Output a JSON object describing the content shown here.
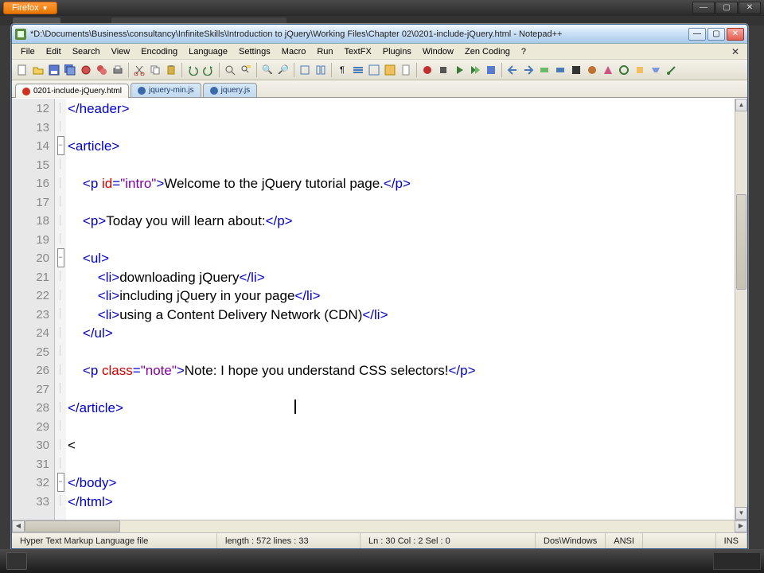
{
  "browser": {
    "name": "Firefox"
  },
  "npp": {
    "title": "*D:\\Documents\\Business\\consultancy\\InfiniteSkills\\Introduction to jQuery\\Working Files\\Chapter 02\\0201-include-jQuery.html - Notepad++",
    "menu": [
      "File",
      "Edit",
      "Search",
      "View",
      "Encoding",
      "Language",
      "Settings",
      "Macro",
      "Run",
      "TextFX",
      "Plugins",
      "Window",
      "Zen Coding",
      "?"
    ],
    "tabs": [
      {
        "label": "0201-include-jQuery.html",
        "active": true
      },
      {
        "label": "jquery-min.js",
        "active": false
      },
      {
        "label": "jquery.js",
        "active": false
      }
    ],
    "gutter_start": 12,
    "code_lines": [
      {
        "n": 12,
        "fold": "",
        "html": "<span class='t-tag'>&lt;/header&gt;</span>"
      },
      {
        "n": 13,
        "fold": "",
        "html": ""
      },
      {
        "n": 14,
        "fold": "box",
        "html": "<span class='t-tag'>&lt;article&gt;</span>"
      },
      {
        "n": 15,
        "fold": "",
        "html": ""
      },
      {
        "n": 16,
        "fold": "",
        "html": "    <span class='t-tag'>&lt;p</span> <span class='t-attr'>id</span><span class='t-tag'>=</span><span class='t-str'>\"intro\"</span><span class='t-tag'>&gt;</span><span class='t-text'>Welcome to the jQuery tutorial page.</span><span class='t-tag'>&lt;/p&gt;</span>"
      },
      {
        "n": 17,
        "fold": "",
        "html": ""
      },
      {
        "n": 18,
        "fold": "",
        "html": "    <span class='t-tag'>&lt;p&gt;</span><span class='t-text'>Today you will learn about:</span><span class='t-tag'>&lt;/p&gt;</span>"
      },
      {
        "n": 19,
        "fold": "",
        "html": ""
      },
      {
        "n": 20,
        "fold": "box",
        "html": "    <span class='t-tag'>&lt;ul&gt;</span>"
      },
      {
        "n": 21,
        "fold": "",
        "html": "        <span class='t-tag'>&lt;li&gt;</span><span class='t-text'>downloading jQuery</span><span class='t-tag'>&lt;/li&gt;</span>"
      },
      {
        "n": 22,
        "fold": "",
        "html": "        <span class='t-tag'>&lt;li&gt;</span><span class='t-text'>including jQuery in your page</span><span class='t-tag'>&lt;/li&gt;</span>"
      },
      {
        "n": 23,
        "fold": "",
        "html": "        <span class='t-tag'>&lt;li&gt;</span><span class='t-text'>using a Content Delivery Network (CDN)</span><span class='t-tag'>&lt;/li&gt;</span>"
      },
      {
        "n": 24,
        "fold": "",
        "html": "    <span class='t-tag'>&lt;/ul&gt;</span>"
      },
      {
        "n": 25,
        "fold": "",
        "html": ""
      },
      {
        "n": 26,
        "fold": "",
        "html": "    <span class='t-tag'>&lt;p</span> <span class='t-attr'>class</span><span class='t-tag'>=</span><span class='t-str'>\"note\"</span><span class='t-tag'>&gt;</span><span class='t-text'>Note: I hope you understand CSS selectors!</span><span class='t-tag'>&lt;/p&gt;</span>"
      },
      {
        "n": 27,
        "fold": "",
        "html": ""
      },
      {
        "n": 28,
        "fold": "",
        "html": "<span class='t-tag'>&lt;/article&gt;</span>"
      },
      {
        "n": 29,
        "fold": "",
        "html": ""
      },
      {
        "n": 30,
        "fold": "",
        "html": "<span class='t-text'>&lt;</span>"
      },
      {
        "n": 31,
        "fold": "",
        "html": ""
      },
      {
        "n": 32,
        "fold": "box",
        "html": "<span class='t-tag'>&lt;/body&gt;</span>"
      },
      {
        "n": 33,
        "fold": "",
        "html": "<span class='t-tag'>&lt;/html&gt;</span>"
      }
    ],
    "status": {
      "type": "Hyper Text Markup Language file",
      "length": "length : 572    lines : 33",
      "pos": "Ln : 30    Col : 2    Sel : 0",
      "eol": "Dos\\Windows",
      "enc": "ANSI",
      "ovr": "INS"
    }
  }
}
